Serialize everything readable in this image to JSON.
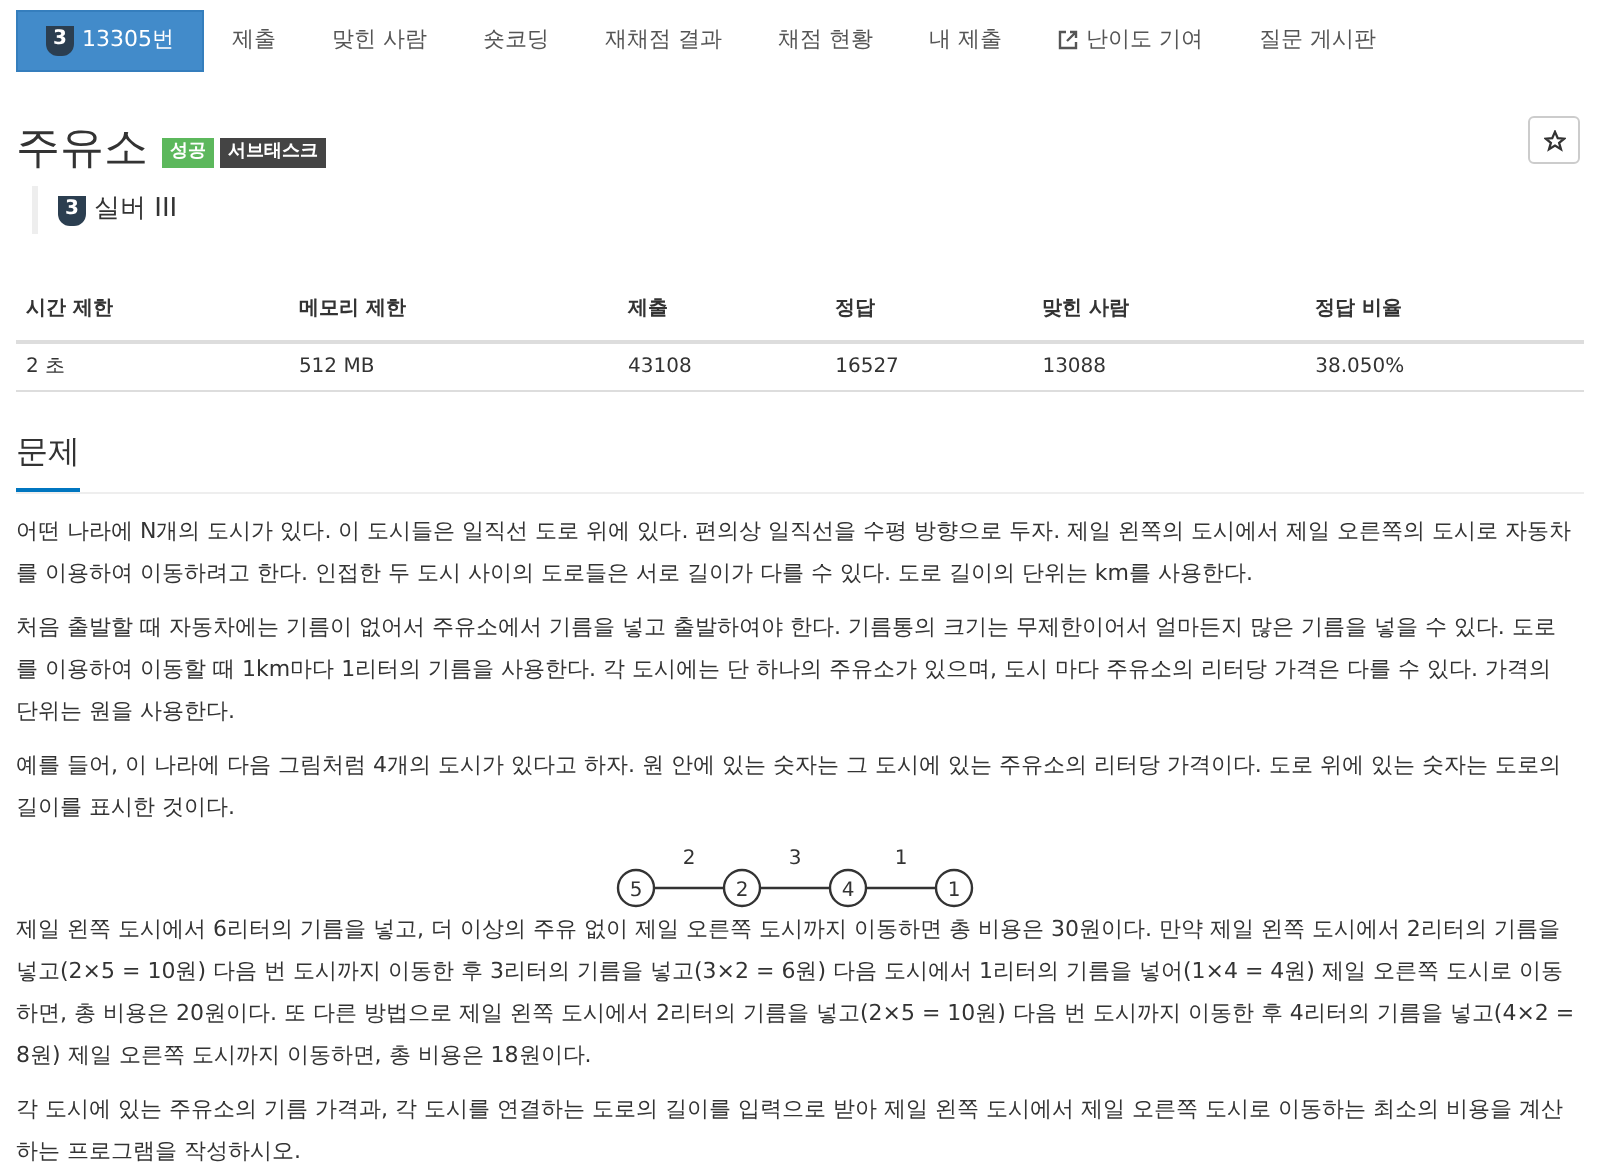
{
  "tabs": [
    {
      "label": "13305번",
      "tier_icon": "3",
      "selected": true,
      "kind": "tier"
    },
    {
      "label": "제출",
      "selected": false,
      "kind": "plain"
    },
    {
      "label": "맞힌 사람",
      "selected": false,
      "kind": "plain"
    },
    {
      "label": "숏코딩",
      "selected": false,
      "kind": "plain"
    },
    {
      "label": "재채점 결과",
      "selected": false,
      "kind": "plain"
    },
    {
      "label": "채점 현황",
      "selected": false,
      "kind": "plain"
    },
    {
      "label": "내 제출",
      "selected": false,
      "kind": "plain"
    },
    {
      "label": "난이도 기여",
      "selected": false,
      "kind": "external"
    },
    {
      "label": "질문 게시판",
      "selected": false,
      "kind": "plain"
    }
  ],
  "problem": {
    "title": "주유소",
    "badges": [
      {
        "label": "성공",
        "color": "#5cb85c"
      },
      {
        "label": "서브태스크",
        "color": "#444444"
      }
    ],
    "tier": {
      "icon": "3",
      "label": "실버 III"
    }
  },
  "stats": {
    "columns": [
      "시간 제한",
      "메모리 제한",
      "제출",
      "정답",
      "맞힌 사람",
      "정답 비율"
    ],
    "values": [
      "2 초",
      "512 MB",
      "43108",
      "16527",
      "13088",
      "38.050%"
    ]
  },
  "section": {
    "heading": "문제",
    "paragraphs_before": [
      "어떤 나라에 N개의 도시가 있다. 이 도시들은 일직선 도로 위에 있다. 편의상 일직선을 수평 방향으로 두자. 제일 왼쪽의 도시에서 제일 오른쪽의 도시로 자동차를 이용하여 이동하려고 한다. 인접한 두 도시 사이의 도로들은 서로 길이가 다를 수 있다. 도로 길이의 단위는 km를 사용한다.",
      "처음 출발할 때 자동차에는 기름이 없어서 주유소에서 기름을 넣고 출발하여야 한다. 기름통의 크기는 무제한이어서 얼마든지 많은 기름을 넣을 수 있다. 도로를 이용하여 이동할 때 1km마다 1리터의 기름을 사용한다. 각 도시에는 단 하나의 주유소가 있으며, 도시 마다 주유소의 리터당 가격은 다를 수 있다. 가격의 단위는 원을 사용한다.",
      "예를 들어, 이 나라에 다음 그림처럼 4개의 도시가 있다고 하자. 원 안에 있는 숫자는 그 도시에 있는 주유소의 리터당 가격이다. 도로 위에 있는 숫자는 도로의 길이를 표시한 것이다."
    ],
    "diagram": {
      "nodes": [
        "5",
        "2",
        "4",
        "1"
      ],
      "edges": [
        "2",
        "3",
        "1"
      ]
    },
    "paragraphs_after": [
      "제일 왼쪽 도시에서 6리터의 기름을 넣고, 더 이상의 주유 없이 제일 오른쪽 도시까지 이동하면 총 비용은 30원이다. 만약 제일 왼쪽 도시에서 2리터의 기름을 넣고(2×5 = 10원) 다음 번 도시까지 이동한 후 3리터의 기름을 넣고(3×2 = 6원) 다음 도시에서 1리터의 기름을 넣어(1×4 = 4원) 제일 오른쪽 도시로 이동하면, 총 비용은 20원이다. 또 다른 방법으로 제일 왼쪽 도시에서 2리터의 기름을 넣고(2×5 = 10원) 다음 번 도시까지 이동한 후 4리터의 기름을 넣고(4×2 = 8원) 제일 오른쪽 도시까지 이동하면, 총 비용은 18원이다.",
      "각 도시에 있는 주유소의 기름 가격과, 각 도시를 연결하는 도로의 길이를 입력으로 받아 제일 왼쪽 도시에서 제일 오른쪽 도시로 이동하는 최소의 비용을 계산하는 프로그램을 작성하시오."
    ]
  }
}
